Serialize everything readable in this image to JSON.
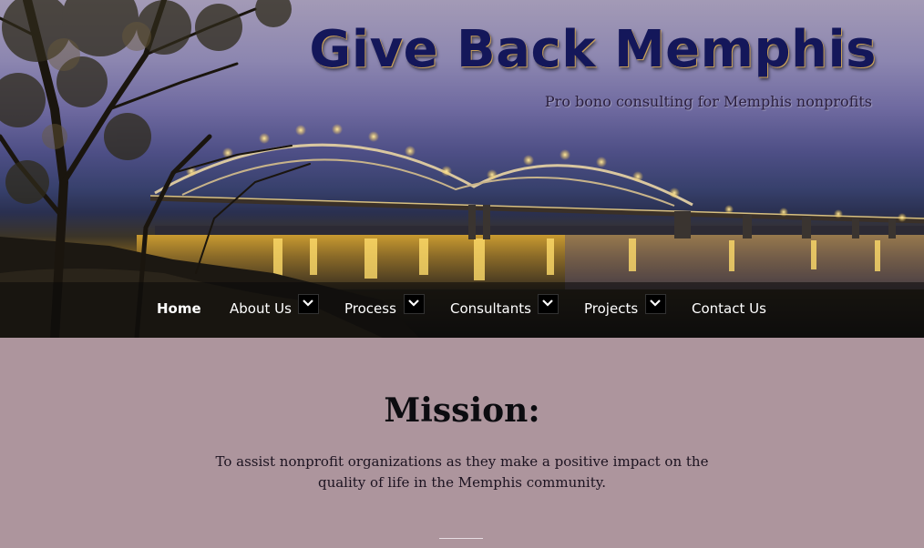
{
  "header": {
    "title": "Give Back Memphis",
    "tagline": "Pro bono consulting for Memphis nonprofits"
  },
  "nav": {
    "items": [
      {
        "label": "Home",
        "active": true
      },
      {
        "label": "About Us",
        "has_dropdown": true
      },
      {
        "label": "Process",
        "has_dropdown": true
      },
      {
        "label": "Consultants",
        "has_dropdown": true
      },
      {
        "label": "Projects",
        "has_dropdown": true
      },
      {
        "label": "Contact Us"
      }
    ]
  },
  "mission": {
    "title": "Mission:",
    "text": "To assist nonprofit organizations as they make a positive impact on the quality of life in the Memphis community."
  },
  "colors": {
    "page_background": "#ad959d",
    "title_color": "#14175a",
    "navbar_background": "rgba(10,10,10,0.55)"
  },
  "icons": {
    "dropdown": "chevron-down-icon"
  }
}
